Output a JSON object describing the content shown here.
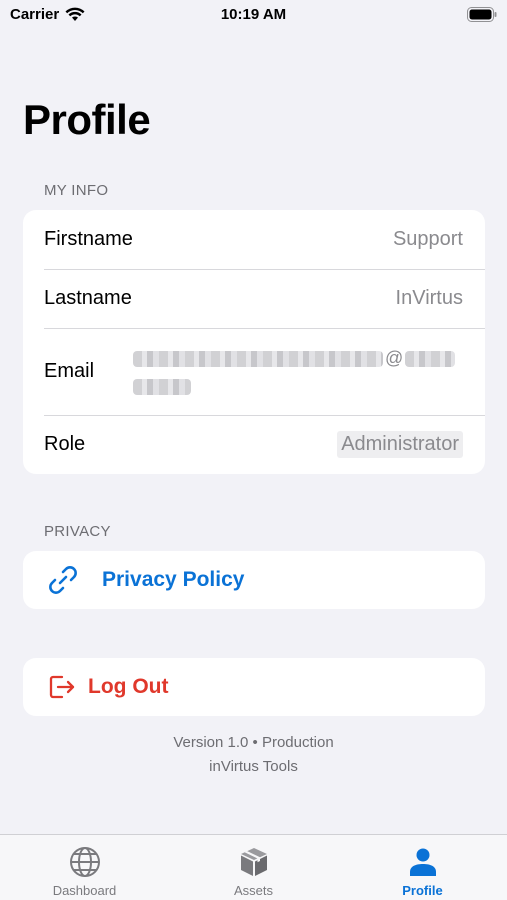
{
  "status_bar": {
    "carrier": "Carrier",
    "time": "10:19 AM"
  },
  "page": {
    "title": "Profile"
  },
  "my_info": {
    "header": "MY INFO",
    "firstname": {
      "label": "Firstname",
      "value": "Support"
    },
    "lastname": {
      "label": "Lastname",
      "value": "InVirtus"
    },
    "email": {
      "label": "Email",
      "at": "@"
    },
    "role": {
      "label": "Role",
      "value": "Administrator"
    }
  },
  "privacy": {
    "header": "PRIVACY",
    "policy_label": "Privacy Policy"
  },
  "logout": {
    "label": "Log Out"
  },
  "footer": {
    "version": "Version 1.0 • Production",
    "app_name": "inVirtus Tools"
  },
  "tab_bar": {
    "tabs": [
      {
        "label": "Dashboard",
        "icon": "globe-icon"
      },
      {
        "label": "Assets",
        "icon": "box-icon"
      },
      {
        "label": "Profile",
        "icon": "person-icon"
      }
    ],
    "active": "Profile"
  },
  "colors": {
    "accent": "#0a72d6",
    "destructive": "#e0382b",
    "background": "#f2f2f7"
  }
}
